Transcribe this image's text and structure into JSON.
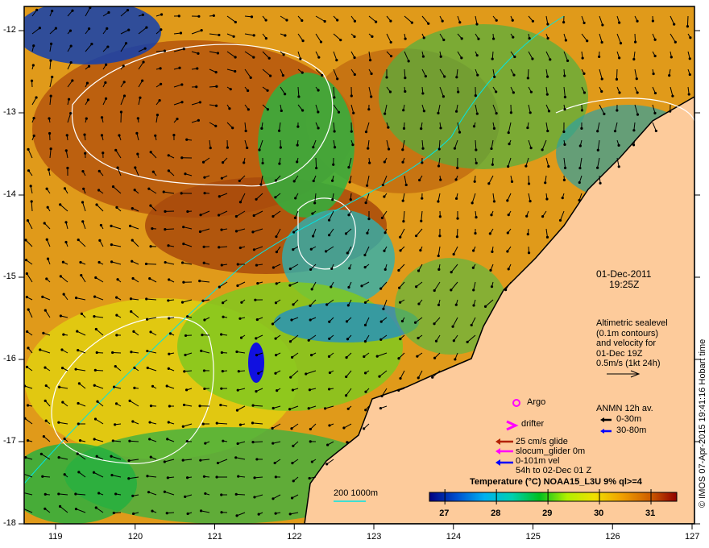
{
  "map": {
    "lon_ticks": [
      "119",
      "120",
      "121",
      "122",
      "123",
      "124",
      "125",
      "126",
      "127"
    ],
    "lat_ticks": [
      "-12",
      "-13",
      "-14",
      "-15",
      "-16",
      "-17",
      "-18"
    ],
    "land_color": "#fdcb9b",
    "date": "01-Dec-2011",
    "time": "19:25Z",
    "altimetry_lines": [
      "Altimetric sealevel",
      "(0.1m contours)",
      "and velocity for",
      "01-Dec 19Z",
      "0.5m/s (1kt 24h)"
    ],
    "legend": {
      "argo": "Argo",
      "drifter": "drifter",
      "glide": "25 cm/s glide",
      "slocum": "slocum_glider 0m",
      "vel": "0-101m vel",
      "vel_period": "54h to 02-Dec 01 Z",
      "anmn_title": "ANMN 12h av.",
      "anmn_shallow": "0-30m",
      "anmn_deep": "30-80m",
      "colors": {
        "argo": "#ff00ff",
        "drifter": "#ff00ff",
        "glide": "#b22200",
        "slocum": "#ff00ff",
        "vel": "#0000ff",
        "anmn_shallow": "#000000",
        "anmn_deep": "#0000ff",
        "bathy": "#00e5e5"
      }
    },
    "bathy_label": "200  1000m",
    "colorbar": {
      "title": "Temperature (°C) NOAA15_L3U 9% ql>=4",
      "ticks": [
        "27",
        "28",
        "29",
        "30",
        "31"
      ],
      "range": [
        26.7,
        31.5
      ],
      "colors": [
        "#000080",
        "#0050d0",
        "#00b0f0",
        "#00d0b0",
        "#00c020",
        "#b0f000",
        "#f0e000",
        "#f0a000",
        "#d06000",
        "#900000"
      ]
    },
    "credit": "© IMOS 07-Apr-2015 19:41:16 Hobart time"
  }
}
